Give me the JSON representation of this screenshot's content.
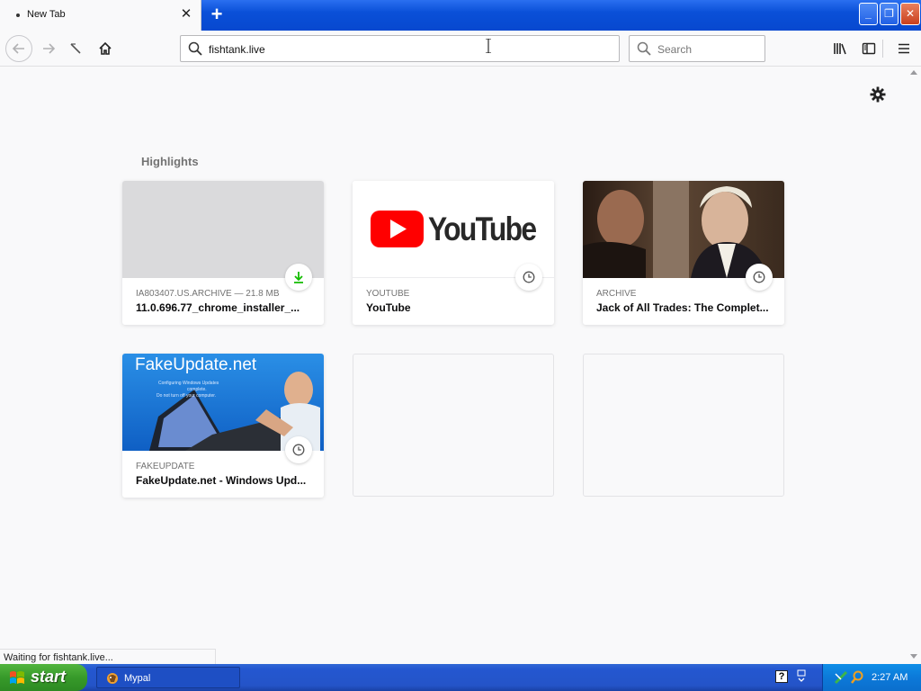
{
  "browser": {
    "tab_title": "New Tab",
    "tab_close": "✕",
    "new_tab": "+",
    "url": "fishtank.live",
    "search_placeholder": "Search"
  },
  "window_controls": {
    "minimize": "_",
    "maximize": "❐",
    "close": "✕"
  },
  "newtab": {
    "section_title": "Highlights",
    "cards": [
      {
        "meta": "IA803407.US.ARCHIVE — 21.8 MB",
        "title": "11.0.696.77_chrome_installer_...",
        "badge": "download-icon"
      },
      {
        "meta": "YOUTUBE",
        "title": "YouTube",
        "badge": "clock-icon",
        "logo_text": "YouTube"
      },
      {
        "meta": "ARCHIVE",
        "title": "Jack of All Trades: The Complet...",
        "badge": "clock-icon"
      },
      {
        "meta": "FAKEUPDATE",
        "title": "FakeUpdate.net - Windows Upd...",
        "badge": "clock-icon",
        "thumb_heading": "FakeUpdate.net",
        "thumb_line1": "Configuring Windows Updates",
        "thumb_line2": "complete.",
        "thumb_line3": "Do not turn off your computer."
      }
    ]
  },
  "status_text": "Waiting for fishtank.live...",
  "taskbar": {
    "start_label": "start",
    "task_label": "Mypal",
    "help": "?",
    "clock": "2:27 AM"
  },
  "colors": {
    "accent_blue": "#0a50d8",
    "start_green": "#379a2a",
    "download_green": "#12bc00"
  }
}
